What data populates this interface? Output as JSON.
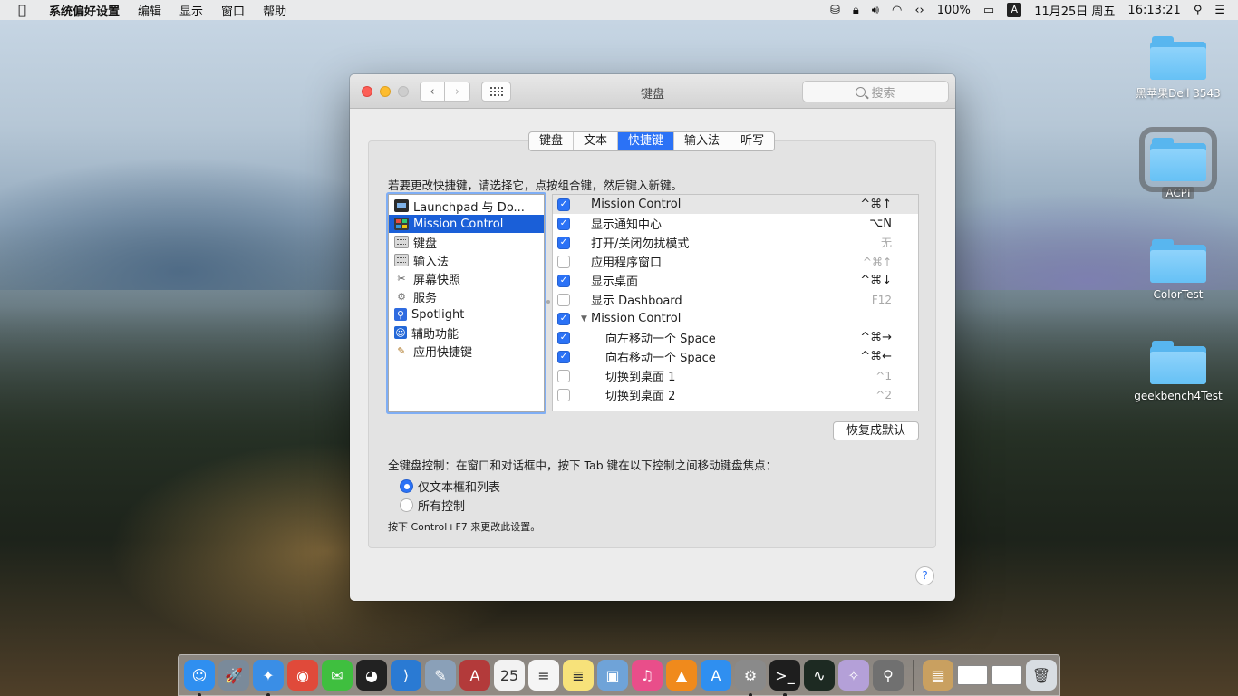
{
  "menubar": {
    "apple": "",
    "items": [
      "系统偏好设置",
      "编辑",
      "显示",
      "窗口",
      "帮助"
    ],
    "battery": "100%",
    "ime": "A",
    "date": "11月25日 周五",
    "time": "16:13:21"
  },
  "window": {
    "title": "键盘",
    "search_placeholder": "搜索",
    "tabs": [
      "键盘",
      "文本",
      "快捷键",
      "输入法",
      "听写"
    ],
    "active_tab": "快捷键",
    "instruction": "若要更改快捷键，请选择它，点按组合键，然后键入新键。",
    "categories": [
      {
        "label": "Launchpad 与 Do...",
        "icon": "launchpad-icon"
      },
      {
        "label": "Mission Control",
        "icon": "mission-control-icon",
        "selected": true
      },
      {
        "label": "键盘",
        "icon": "keyboard-icon"
      },
      {
        "label": "输入法",
        "icon": "keyboard-icon"
      },
      {
        "label": "屏幕快照",
        "icon": "screenshot-icon"
      },
      {
        "label": "服务",
        "icon": "gear-icon"
      },
      {
        "label": "Spotlight",
        "icon": "spotlight-icon"
      },
      {
        "label": "辅助功能",
        "icon": "accessibility-icon"
      },
      {
        "label": "应用快捷键",
        "icon": "app-shortcuts-icon"
      }
    ],
    "shortcuts": [
      {
        "checked": true,
        "label": "Mission Control",
        "key": "^⌘↑",
        "dim": false,
        "indent": false,
        "group": false
      },
      {
        "checked": true,
        "label": "显示通知中心",
        "key": "⌥N",
        "dim": false,
        "indent": false,
        "group": false
      },
      {
        "checked": true,
        "label": "打开/关闭勿扰模式",
        "key": "无",
        "dim": true,
        "indent": false,
        "group": false
      },
      {
        "checked": false,
        "label": "应用程序窗口",
        "key": "^⌘↑",
        "dim": true,
        "indent": false,
        "group": false
      },
      {
        "checked": true,
        "label": "显示桌面",
        "key": "^⌘↓",
        "dim": false,
        "indent": false,
        "group": false
      },
      {
        "checked": false,
        "label": "显示 Dashboard",
        "key": "F12",
        "dim": true,
        "indent": false,
        "group": false
      },
      {
        "checked": true,
        "label": "Mission Control",
        "key": "",
        "dim": false,
        "indent": false,
        "group": true
      },
      {
        "checked": true,
        "label": "向左移动一个 Space",
        "key": "^⌘→",
        "dim": false,
        "indent": true,
        "group": false
      },
      {
        "checked": true,
        "label": "向右移动一个 Space",
        "key": "^⌘←",
        "dim": false,
        "indent": true,
        "group": false
      },
      {
        "checked": false,
        "label": "切换到桌面 1",
        "key": "^1",
        "dim": true,
        "indent": true,
        "group": false
      },
      {
        "checked": false,
        "label": "切换到桌面 2",
        "key": "^2",
        "dim": true,
        "indent": true,
        "group": false
      }
    ],
    "restore_label": "恢复成默认",
    "fkc_label": "全键盘控制：在窗口和对话框中，按下 Tab 键在以下控制之间移动键盘焦点：",
    "radio_text_lists": "仅文本框和列表",
    "radio_all": "所有控制",
    "radio_selected": "text_lists",
    "hint": "按下 Control+F7 来更改此设置。",
    "help": "?"
  },
  "desktop": [
    {
      "label": "黑苹果Dell 3543",
      "selected": false
    },
    {
      "label": "ACPI",
      "selected": true
    },
    {
      "label": "ColorTest",
      "selected": false
    },
    {
      "label": "geekbench4Test",
      "selected": false
    }
  ],
  "dock": [
    {
      "name": "finder-icon",
      "color": "#2f8ff0",
      "glyph": "☺",
      "running": true
    },
    {
      "name": "launchpad-icon",
      "color": "#7a8a9a",
      "glyph": "🚀",
      "running": false
    },
    {
      "name": "safari-icon",
      "color": "#3a8ee6",
      "glyph": "✦",
      "running": true
    },
    {
      "name": "chrome-icon",
      "color": "#e04a3a",
      "glyph": "◉",
      "running": false
    },
    {
      "name": "wechat-icon",
      "color": "#3fbf3f",
      "glyph": "✉",
      "running": false
    },
    {
      "name": "qq-icon",
      "color": "#222222",
      "glyph": "◕",
      "running": false
    },
    {
      "name": "vscode-icon",
      "color": "#2a7ad3",
      "glyph": "⟩",
      "running": false
    },
    {
      "name": "preview-icon",
      "color": "#8aa0b8",
      "glyph": "✎",
      "running": false
    },
    {
      "name": "dictionary-icon",
      "color": "#b33a3a",
      "glyph": "A",
      "running": false
    },
    {
      "name": "calendar-icon",
      "color": "#f2f2f2",
      "glyph": "25",
      "running": false
    },
    {
      "name": "reminders-icon",
      "color": "#f5f5f5",
      "glyph": "≡",
      "running": false
    },
    {
      "name": "notes-icon",
      "color": "#f7e27a",
      "glyph": "≣",
      "running": false
    },
    {
      "name": "photos-icon",
      "color": "#6fa3d8",
      "glyph": "▣",
      "running": false
    },
    {
      "name": "itunes-icon",
      "color": "#e94e8a",
      "glyph": "♫",
      "running": false
    },
    {
      "name": "vlc-icon",
      "color": "#f08a1c",
      "glyph": "▲",
      "running": false
    },
    {
      "name": "app-store-icon",
      "color": "#2f8ff0",
      "glyph": "A",
      "running": false
    },
    {
      "name": "system-preferences-icon",
      "color": "#8a8a8a",
      "glyph": "⚙",
      "running": true
    },
    {
      "name": "terminal-icon",
      "color": "#1e1e1e",
      "glyph": ">_",
      "running": true
    },
    {
      "name": "activity-monitor-icon",
      "color": "#1d2a22",
      "glyph": "∿",
      "running": false
    },
    {
      "name": "wizard-icon",
      "color": "#b4a0d8",
      "glyph": "✧",
      "running": false
    },
    {
      "name": "usb-icon",
      "color": "#707070",
      "glyph": "⚲",
      "running": false
    },
    {
      "name": "archive-icon",
      "color": "#c9a060",
      "glyph": "▤",
      "running": false
    },
    {
      "name": "window-thumb-1-icon",
      "color": "#ffffff",
      "glyph": "",
      "running": false
    },
    {
      "name": "window-thumb-2-icon",
      "color": "#ffffff",
      "glyph": "",
      "running": false
    },
    {
      "name": "trash-icon",
      "color": "#d8dde2",
      "glyph": "🗑",
      "running": false
    }
  ]
}
